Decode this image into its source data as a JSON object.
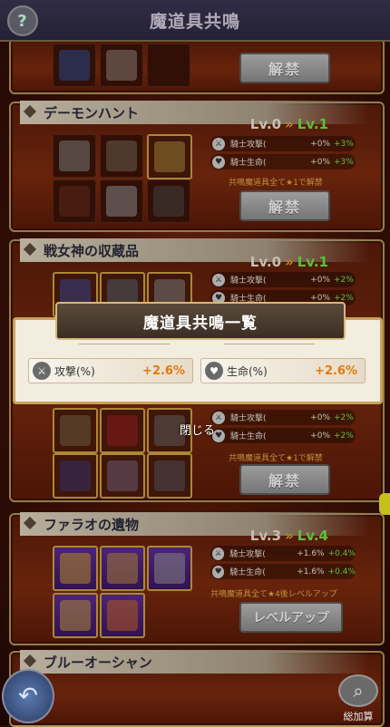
{
  "header": {
    "title": "魔道具共鳴",
    "help": "?"
  },
  "cards": [
    {
      "title": "",
      "button": "解禁"
    },
    {
      "title": "デーモンハント",
      "lv_cur": "Lv.0",
      "lv_next": "Lv.1",
      "stats": [
        {
          "name": "騎士攻撃(",
          "v1": "+0%",
          "v2": "+3%"
        },
        {
          "name": "騎士生命(",
          "v1": "+0%",
          "v2": "+3%"
        }
      ],
      "note": "共鳴魔道具全て★1で解禁",
      "button": "解禁"
    },
    {
      "title": "戦女神の収蔵品",
      "lv_cur": "Lv.0",
      "lv_next": "Lv.1",
      "stats": [
        {
          "name": "騎士攻撃(",
          "v1": "+0%",
          "v2": "+2%"
        },
        {
          "name": "騎士生命(",
          "v1": "+0%",
          "v2": "+2%"
        },
        {
          "name": "騎士攻撃(",
          "v1": "+0%",
          "v2": "+2%"
        },
        {
          "name": "騎士生命(",
          "v1": "+0%",
          "v2": "+2%"
        }
      ],
      "note": "共鳴魔道具全て★1で解禁",
      "button": "解禁"
    },
    {
      "title": "ファラオの遺物",
      "lv_cur": "Lv.3",
      "lv_next": "Lv.4",
      "stats": [
        {
          "name": "騎士攻撃(",
          "v1": "+1.6%",
          "v2": "+0.4%"
        },
        {
          "name": "騎士生命(",
          "v1": "+1.6%",
          "v2": "+0.4%"
        }
      ],
      "note": "共鳴魔道具全て★4後レベルアップ",
      "button": "レベルアップ"
    },
    {
      "title": "ブルーオーシャン"
    }
  ],
  "modal": {
    "title": "魔道具共鳴一覧",
    "attack_label": "攻撃(%)",
    "attack_value": "+2.6%",
    "hp_label": "生命(%)",
    "hp_value": "+2.6%",
    "close": "閉じる"
  },
  "footer": {
    "sum_label": "総加算"
  },
  "colors": {
    "next_level": "#6ee04a",
    "modal_value": "#e07a10"
  }
}
